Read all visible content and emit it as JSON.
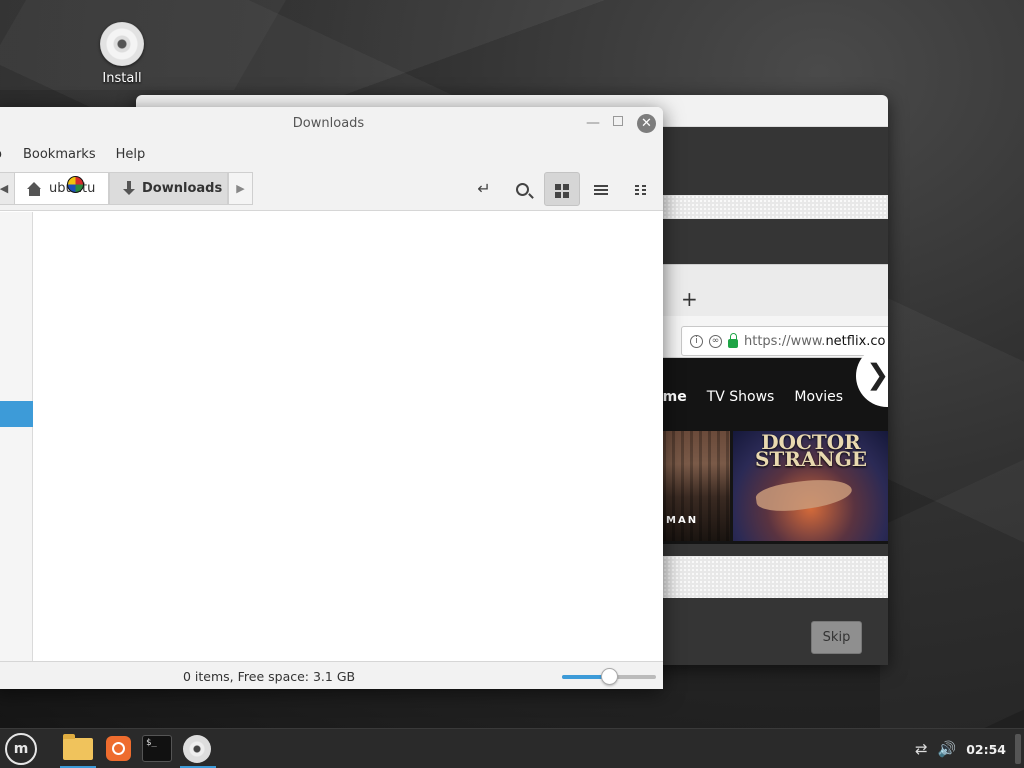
{
  "desktop": {
    "icon_label": "Install"
  },
  "installer": {
    "skip_label": "Skip",
    "browser": {
      "new_tab_symbol": "+",
      "url_prefix": "https://www.",
      "url_domain": "netflix.co",
      "nav": [
        "ome",
        "TV Shows",
        "Movies"
      ],
      "next_arrow": "❯",
      "tile1_text": "MAN",
      "tile2_title": "DOCTOR STRANGE"
    }
  },
  "files": {
    "title": "Downloads",
    "menu": [
      "o",
      "Bookmarks",
      "Help"
    ],
    "breadcrumbs": {
      "home": "ubuntu",
      "current": "Downloads"
    },
    "status": "0 items, Free space: 3.1 GB",
    "zoom_level": 0.5,
    "icons": {
      "home": "home-icon",
      "downloads": "download-icon",
      "search": "search-icon",
      "toggle_location": "location-toggle-icon"
    }
  },
  "taskbar": {
    "menu_glyph": "m",
    "terminal_glyph": "$_",
    "clock": "02:54"
  },
  "colors": {
    "accent": "#3d9bd8",
    "taskbar": "#2a2a2a"
  }
}
